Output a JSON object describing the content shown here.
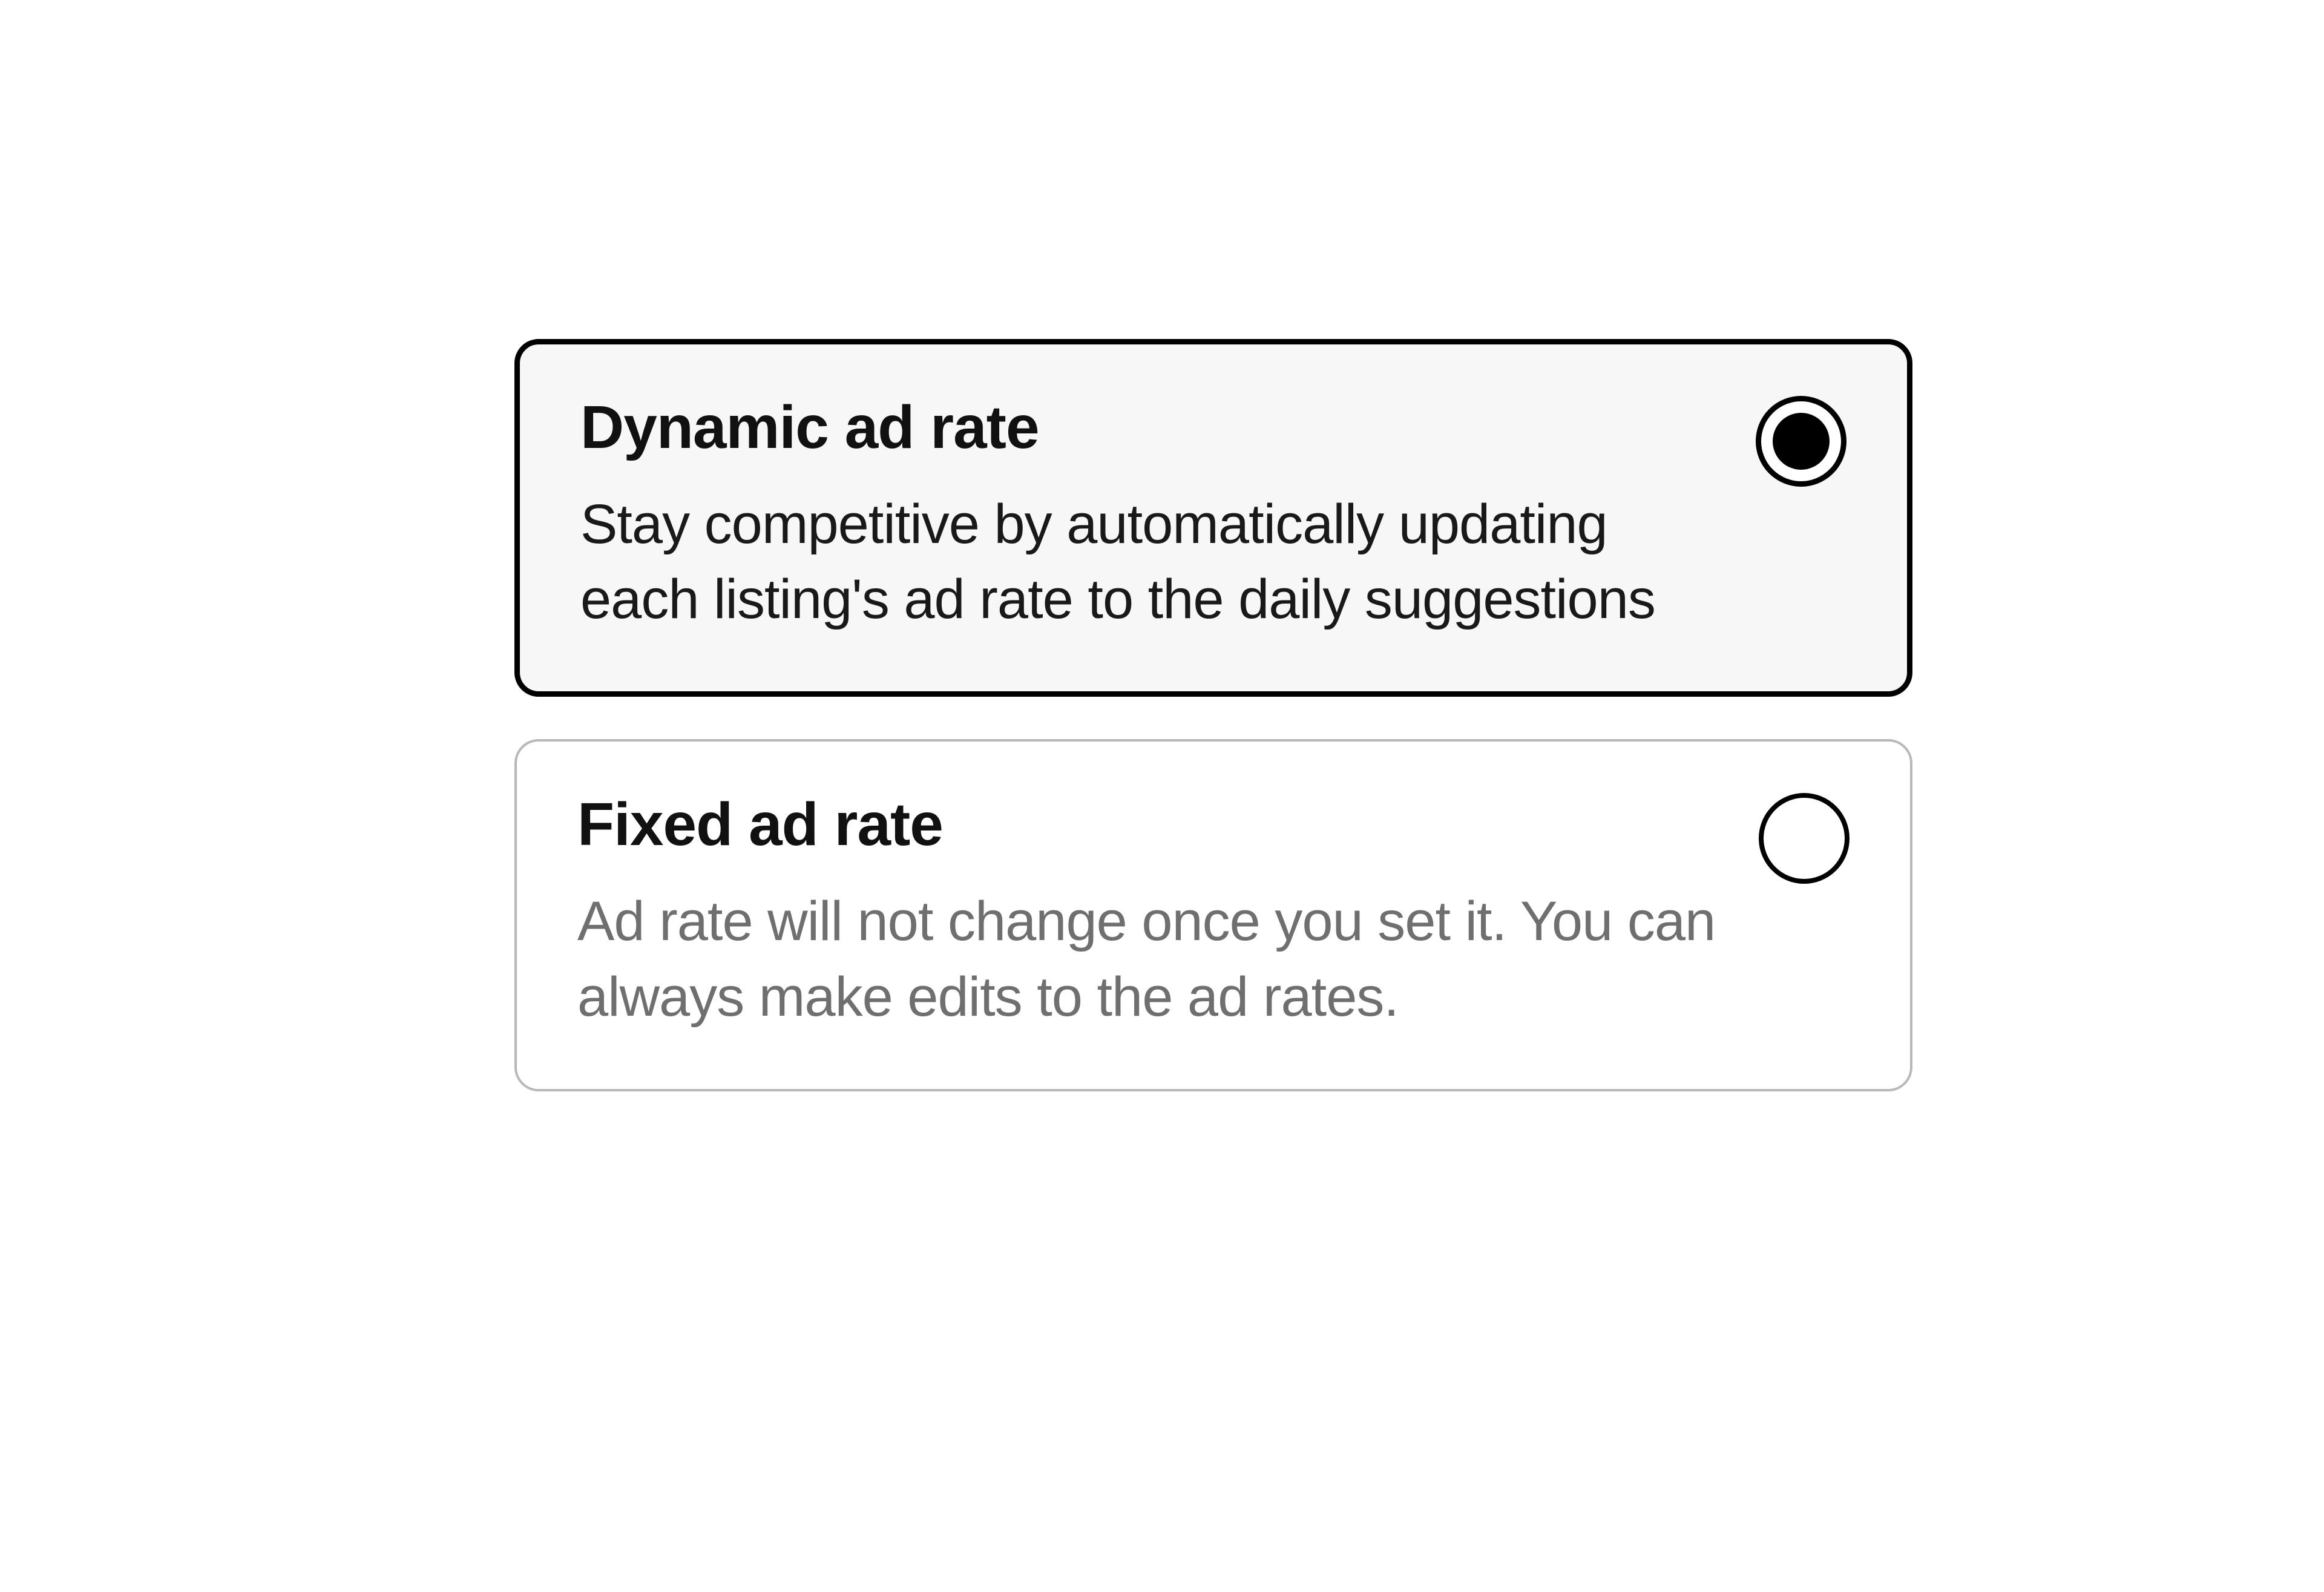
{
  "options": [
    {
      "id": "dynamic",
      "title": "Dynamic ad rate",
      "description": "Stay competitive by automatically updating each listing's ad rate to the daily suggestions",
      "selected": true
    },
    {
      "id": "fixed",
      "title": "Fixed ad rate",
      "description": "Ad rate will not change once you set it. You can always make edits to the ad rates.",
      "selected": false
    }
  ]
}
